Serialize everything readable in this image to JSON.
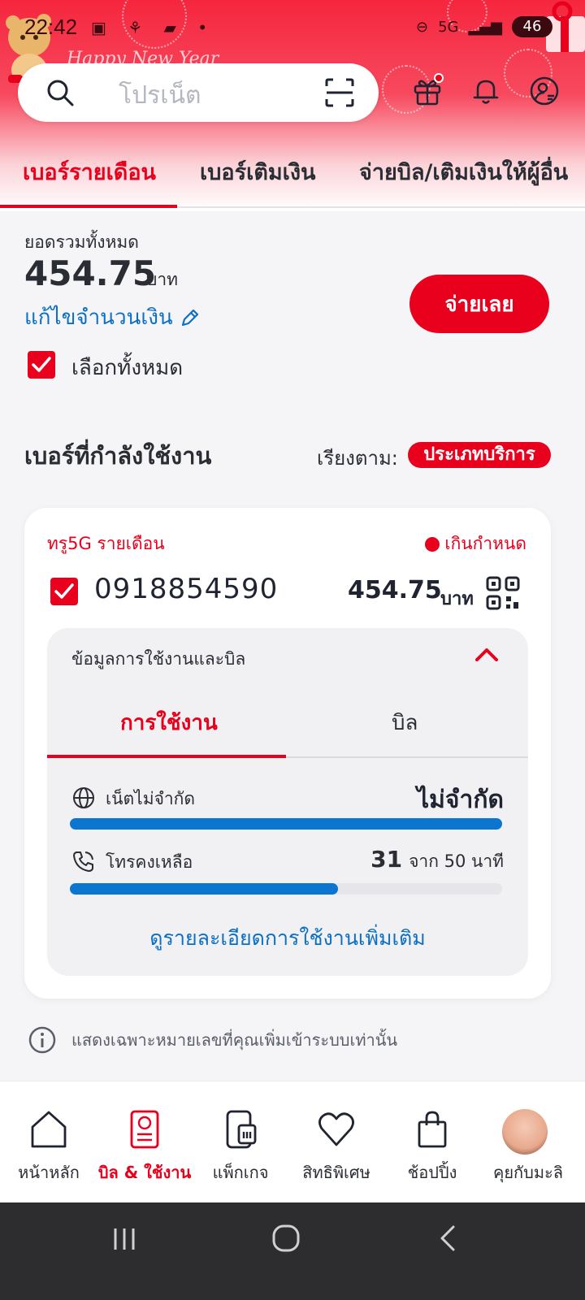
{
  "status_bar": {
    "time": "22:42",
    "battery": "46"
  },
  "header": {
    "decoration_text": "Happy New Year",
    "search": {
      "placeholder": "โปรเน็ต"
    },
    "tabs": [
      {
        "label": "เบอร์รายเดือน",
        "active": true
      },
      {
        "label": "เบอร์เติมเงิน",
        "active": false
      },
      {
        "label": "จ่ายบิล/เติมเงินให้ผู้อื่น",
        "active": false
      }
    ]
  },
  "summary": {
    "total_label": "ยอดรวมทั้งหมด",
    "total_amount": "454.75",
    "unit": "บาท",
    "edit_link": "แก้ไขจำนวนเงิน",
    "pay_button": "จ่ายเลย",
    "select_all": "เลือกทั้งหมด"
  },
  "active_numbers": {
    "heading": "เบอร์ที่กำลังใช้งาน",
    "sort_label": "เรียงตาม:",
    "sort_value": "ประเภทบริการ"
  },
  "card": {
    "plan_name": "ทรู5G รายเดือน",
    "status": "เกินกำหนด",
    "phone_number": "0918854590",
    "amount": "454.75",
    "unit": "บาท",
    "usage_panel": {
      "title": "ข้อมูลการใช้งานและบิล",
      "tabs": [
        {
          "label": "การใช้งาน",
          "active": true
        },
        {
          "label": "บิล",
          "active": false
        }
      ],
      "internet": {
        "label": "เน็ตไม่จำกัด",
        "value": "ไม่จำกัด",
        "fill_fraction": 1.0
      },
      "calls": {
        "label": "โทรคงเหลือ",
        "remaining": "31",
        "of_text": "จาก 50 นาที",
        "fill_fraction": 0.62
      },
      "more_link": "ดูรายละเอียดการใช้งานเพิ่มเติม"
    }
  },
  "info_note": "แสดงเฉพาะหมายเลขที่คุณเพิ่มเข้าระบบเท่านั้น",
  "bottom_nav": [
    {
      "label": "หน้าหลัก",
      "icon": "home-icon",
      "active": false
    },
    {
      "label": "บิล & ใช้งาน",
      "icon": "bill-icon",
      "active": true
    },
    {
      "label": "แพ็กเกจ",
      "icon": "package-icon",
      "active": false
    },
    {
      "label": "สิทธิพิเศษ",
      "icon": "heart-icon",
      "active": false
    },
    {
      "label": "ช้อปปิ้ง",
      "icon": "shopping-bag-icon",
      "active": false
    },
    {
      "label": "คุยกับมะลิ",
      "icon": "avatar",
      "active": false
    }
  ],
  "colors": {
    "accent": "#e8001c",
    "link": "#0b6fc6",
    "progress": "#0b75d0"
  }
}
